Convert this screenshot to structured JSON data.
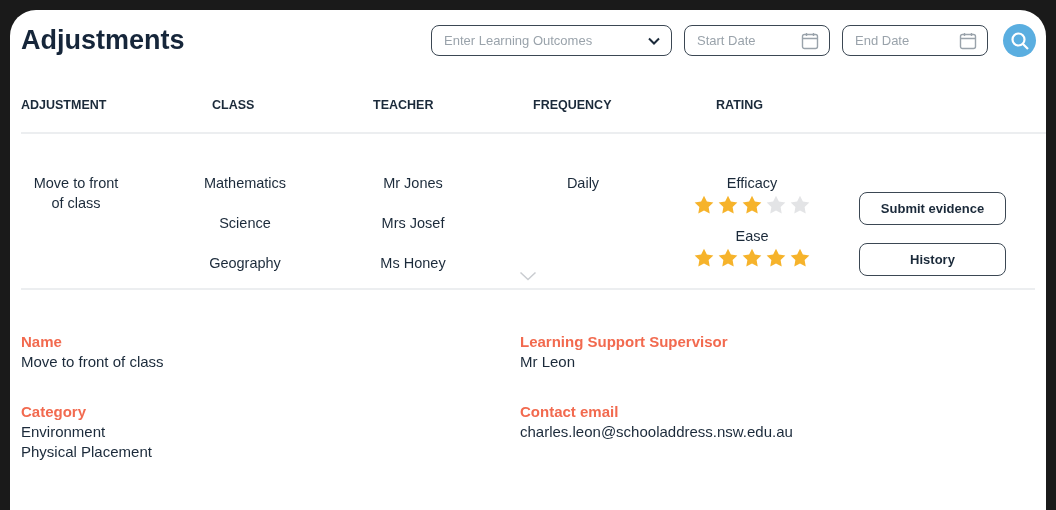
{
  "page": {
    "title": "Adjustments"
  },
  "filters": {
    "outcomes": {
      "placeholder": "Enter Learning Outcomes"
    },
    "start_date": {
      "placeholder": "Start Date"
    },
    "end_date": {
      "placeholder": "End Date"
    }
  },
  "table": {
    "columns": [
      "ADJUSTMENT",
      "CLASS",
      "TEACHER",
      "FREQUENCY",
      "RATING"
    ],
    "rows": [
      {
        "adjustment": "Move to front of class",
        "classes": [
          {
            "class": "Mathematics",
            "teacher": "Mr Jones"
          },
          {
            "class": "Science",
            "teacher": "Mrs Josef"
          },
          {
            "class": "Geography",
            "teacher": "Ms Honey"
          }
        ],
        "frequency": "Daily",
        "ratings": [
          {
            "label": "Efficacy",
            "stars": 3
          },
          {
            "label": "Ease",
            "stars": 5
          }
        ],
        "buttons": [
          "Submit evidence",
          "History"
        ]
      }
    ]
  },
  "details": [
    {
      "label": "Name",
      "values": [
        "Move to front of class"
      ]
    },
    {
      "label": "Learning Support Supervisor",
      "values": [
        "Mr Leon"
      ]
    },
    {
      "label": "Category",
      "values": [
        "Environment",
        "Physical Placement"
      ]
    },
    {
      "label": "Contact email",
      "values": [
        "charles.leon@schooladdress.nsw.edu.au"
      ]
    }
  ]
}
